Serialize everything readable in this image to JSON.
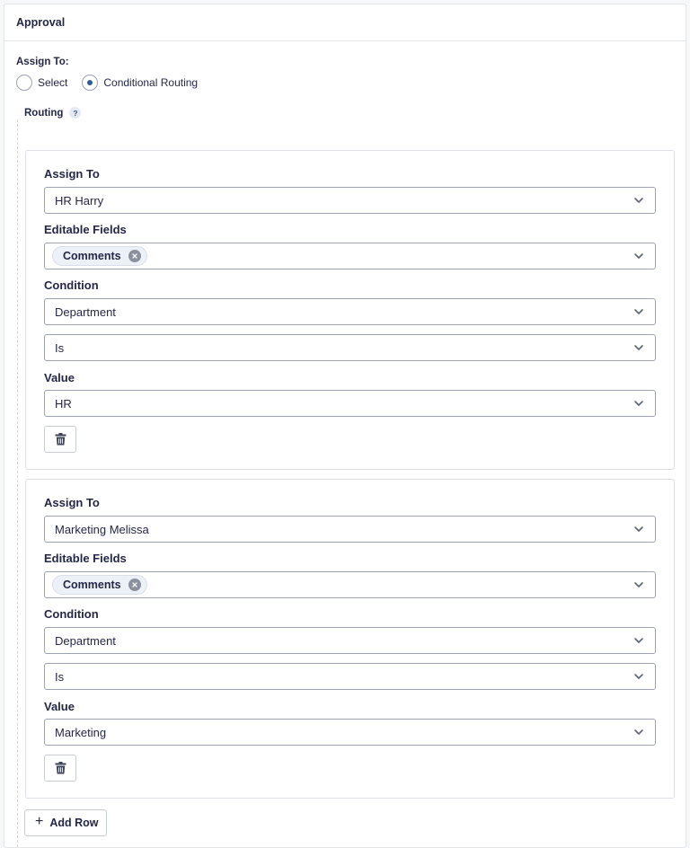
{
  "panel": {
    "title": "Approval"
  },
  "assign": {
    "label": "Assign To:",
    "options": [
      {
        "label": "Select",
        "checked": false
      },
      {
        "label": "Conditional Routing",
        "checked": true
      }
    ]
  },
  "routing": {
    "label": "Routing",
    "help": "?"
  },
  "labels": {
    "assign_to": "Assign To",
    "editable_fields": "Editable Fields",
    "condition": "Condition",
    "value": "Value"
  },
  "routes": [
    {
      "assign_to": "HR Harry",
      "editable_fields": [
        "Comments"
      ],
      "condition_field": "Department",
      "condition_operator": "Is",
      "value": "HR"
    },
    {
      "assign_to": "Marketing Melissa",
      "editable_fields": [
        "Comments"
      ],
      "condition_field": "Department",
      "condition_operator": "Is",
      "value": "Marketing"
    }
  ],
  "add_row": {
    "label": "Add Row",
    "icon": "plus-icon"
  },
  "icons": {
    "select_arrow": "chevron-down-icon",
    "delete": "trash-icon",
    "tag_remove": "close-icon",
    "help": "help-icon"
  },
  "colors": {
    "accent": "#2f5b99",
    "text": "#242748",
    "border": "#9ca2b1"
  }
}
